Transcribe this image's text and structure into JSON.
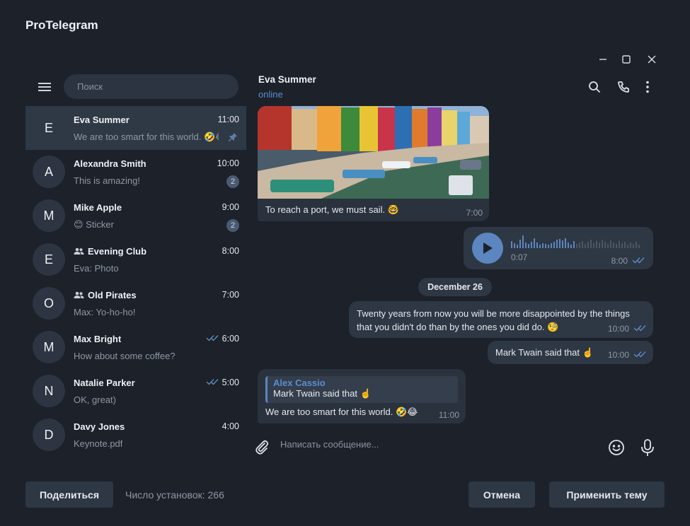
{
  "app": {
    "title": "ProTelegram"
  },
  "window_controls": {
    "minimize_icon": "minimize-icon",
    "maximize_icon": "maximize-icon",
    "close_icon": "close-icon"
  },
  "sidebar": {
    "search_placeholder": "Поиск",
    "chats": [
      {
        "initial": "E",
        "name": "Eva Summer",
        "time": "11:00",
        "preview": "We are too smart for this world. 🤣😂",
        "pinned": true,
        "active": true
      },
      {
        "initial": "A",
        "name": "Alexandra Smith",
        "time": "10:00",
        "preview": "This is amazing!",
        "badge": "2"
      },
      {
        "initial": "M",
        "name": "Mike Apple",
        "time": "9:00",
        "preview": "😊 Sticker",
        "badge": "2"
      },
      {
        "initial": "E",
        "name": "Evening Club",
        "time": "8:00",
        "preview": "Eva: Photo",
        "group": true
      },
      {
        "initial": "O",
        "name": "Old Pirates",
        "time": "7:00",
        "preview": "Max: Yo-ho-ho!",
        "group": true
      },
      {
        "initial": "M",
        "name": "Max Bright",
        "time": "6:00",
        "preview": "How about some coffee?",
        "read": true
      },
      {
        "initial": "N",
        "name": "Natalie Parker",
        "time": "5:00",
        "preview": "OK, great)",
        "read": true
      },
      {
        "initial": "D",
        "name": "Davy Jones",
        "time": "4:00",
        "preview": "Keynote.pdf"
      }
    ]
  },
  "chat": {
    "peer_name": "Eva Summer",
    "peer_status": "online",
    "photo_message": {
      "caption": "To reach a port, we must sail. 🤓",
      "time": "7:00"
    },
    "voice_message": {
      "duration": "0:07",
      "time": "8:00"
    },
    "date_separator": "December 26",
    "out_message_1": {
      "text": "Twenty years from now you will be more disappointed by the things that you didn't do than by the ones you did do. 🧐",
      "time": "10:00"
    },
    "out_message_2": {
      "text": "Mark Twain said that ☝️",
      "time": "10:00"
    },
    "in_message": {
      "reply_author": "Alex Cassio",
      "reply_text": "Mark Twain said that ☝️",
      "text": "We are too smart for this world. 🤣😂",
      "time": "11:00"
    },
    "composer_placeholder": "Написать сообщение..."
  },
  "footer": {
    "share_label": "Поделиться",
    "installs_text": "Число установок: 266",
    "cancel_label": "Отмена",
    "apply_label": "Применить тему"
  },
  "colors": {
    "background": "#1c212a",
    "accent": "#5b86bf",
    "bubble": "#2e3744",
    "active_row": "#2f3845"
  }
}
